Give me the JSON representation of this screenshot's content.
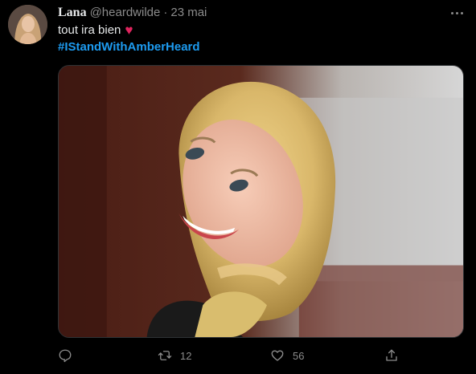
{
  "author": {
    "display_name": "Lana",
    "handle": "@heardwilde",
    "separator": "·",
    "date": "23 mai"
  },
  "tweet": {
    "text": "tout ira bien",
    "emoji": "♥",
    "hashtag": "#IStandWithAmberHeard"
  },
  "actions": {
    "reply_count": "",
    "retweet_count": "12",
    "like_count": "56"
  },
  "icons": {
    "more": "more-icon",
    "reply": "reply-icon",
    "retweet": "retweet-icon",
    "like": "heart-icon",
    "share": "share-icon"
  },
  "colors": {
    "background": "#000000",
    "link": "#1d9bf0",
    "muted": "#8b8b8b",
    "heart": "#e0245e"
  }
}
